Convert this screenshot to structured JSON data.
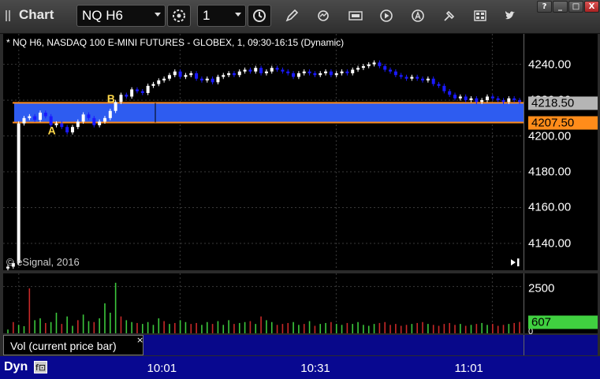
{
  "app": {
    "title": "Chart",
    "symbol_value": "NQ H6",
    "interval_value": "1",
    "window_controls": [
      "?",
      "_",
      "□",
      "X"
    ]
  },
  "chart_info": "* NQ H6, NASDAQ 100 E-MINI FUTURES - GLOBEX, 1, 09:30-16:15 (Dynamic)",
  "copyright": "© eSignal, 2016",
  "study_label": "Vol (current price bar)",
  "study_close": "×",
  "footer_mode": "Dyn",
  "colors": {
    "up_candle": "#ffffff",
    "down_candle": "#1a1aff",
    "zone_fill": "#2e5cf0",
    "zone_line": "#ff8c1a",
    "price_tag_gray": "#b5b5b5",
    "price_tag_orange": "#ff8c1a",
    "vol_up": "#3cc83c",
    "vol_down": "#c82828",
    "vol_tag": "#40d040",
    "time_axis_bg": "#080890"
  },
  "chart_data": [
    {
      "type": "candlestick",
      "title": "* NQ H6, NASDAQ 100 E-MINI FUTURES - GLOBEX, 1, 09:30-16:15 (Dynamic)",
      "ylim": [
        4125,
        4257
      ],
      "y_ticks": [
        "4240.00",
        "4220.00",
        "4200.00",
        "4180.00",
        "4160.00",
        "4140.00"
      ],
      "y_tick_values": [
        4240,
        4220,
        4200,
        4180,
        4160,
        4140
      ],
      "x_ticks": [
        "10:01",
        "10:31",
        "11:01"
      ],
      "grid": true,
      "price_labels": [
        {
          "text": "4218.50",
          "value": 4218.5,
          "style": "gray"
        },
        {
          "text": "4207.50",
          "value": 4207.5,
          "style": "orange"
        }
      ],
      "zone": {
        "from": 4207.5,
        "to": 4218.5
      },
      "markers": [
        {
          "text": "A",
          "bar": 8,
          "value": 4203.0
        },
        {
          "text": "B",
          "bar": 19,
          "value": 4221.0
        }
      ],
      "closes": [
        4127,
        4129,
        4207,
        4210,
        4211,
        4209,
        4213,
        4211,
        4206,
        4207,
        4205,
        4202,
        4205,
        4208,
        4212,
        4210,
        4206,
        4208,
        4210,
        4214,
        4219,
        4223,
        4222,
        4226,
        4225,
        4224,
        4228,
        4229,
        4231,
        4232,
        4234,
        4236,
        4233,
        4234,
        4235,
        4232,
        4231,
        4232,
        4230,
        4233,
        4234,
        4235,
        4234,
        4236,
        4237,
        4236,
        4238,
        4235,
        4236,
        4238,
        4237,
        4236,
        4235,
        4233,
        4235,
        4236,
        4235,
        4234,
        4235,
        4236,
        4234,
        4235,
        4236,
        4235,
        4237,
        4238,
        4239,
        4240,
        4241,
        4239,
        4237,
        4236,
        4234,
        4233,
        4232,
        4233,
        4232,
        4231,
        4232,
        4229,
        4228,
        4225,
        4223,
        4221,
        4222,
        4220,
        4221,
        4219,
        4220,
        4222,
        4221,
        4220,
        4219,
        4221,
        4220,
        4219
      ]
    },
    {
      "type": "bar",
      "title": "Vol (current price bar)",
      "ylim": [
        0,
        3200
      ],
      "y_ticks": [
        "2500",
        "0"
      ],
      "y_tick_values": [
        2500,
        0
      ],
      "last_value_label": "607",
      "last_value": 607,
      "values": [
        200,
        600,
        450,
        380,
        2400,
        700,
        800,
        550,
        600,
        1100,
        500,
        900,
        400,
        700,
        1000,
        650,
        600,
        800,
        1600,
        1100,
        2700,
        900,
        700,
        600,
        550,
        500,
        600,
        450,
        800,
        650,
        500,
        550,
        700,
        600,
        500,
        550,
        450,
        600,
        500,
        650,
        450,
        700,
        500,
        550,
        600,
        650,
        500,
        900,
        700,
        600,
        450,
        500,
        550,
        600,
        450,
        500,
        650,
        400,
        500,
        550,
        600,
        500,
        450,
        550,
        500,
        600,
        450,
        400,
        500,
        550,
        600,
        450,
        500,
        400,
        450,
        500,
        550,
        600,
        500,
        450,
        400,
        500,
        550,
        450,
        500,
        400,
        450,
        500,
        550,
        450,
        500,
        400,
        450,
        500,
        550,
        607
      ],
      "up": [
        1,
        0,
        1,
        1,
        0,
        1,
        1,
        0,
        1,
        1,
        0,
        1,
        1,
        0,
        1,
        1,
        0,
        1,
        1,
        1,
        1,
        0,
        1,
        1,
        0,
        1,
        1,
        1,
        1,
        0,
        1,
        0,
        1,
        1,
        0,
        0,
        1,
        1,
        0,
        1,
        1,
        1,
        0,
        1,
        1,
        0,
        1,
        0,
        1,
        1,
        0,
        0,
        0,
        1,
        1,
        0,
        1,
        0,
        1,
        1,
        0,
        1,
        1,
        0,
        1,
        1,
        1,
        1,
        1,
        0,
        0,
        0,
        0,
        0,
        0,
        1,
        0,
        0,
        1,
        0,
        0,
        0,
        0,
        0,
        1,
        0,
        1,
        0,
        1,
        1,
        0,
        0,
        0,
        1,
        0,
        0
      ]
    }
  ]
}
